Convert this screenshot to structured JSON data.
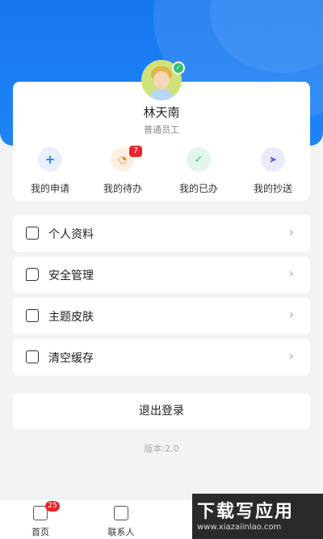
{
  "user": {
    "name": "林天南",
    "role": "普通员工"
  },
  "quick_actions": [
    {
      "label": "我的申请",
      "icon": "plus-icon",
      "color": "#2a7cf0",
      "bg": "#e6f0ff"
    },
    {
      "label": "我的待办",
      "icon": "clock-icon",
      "color": "#f08a24",
      "bg": "#fff0e2",
      "badge": "7"
    },
    {
      "label": "我的已办",
      "icon": "check-icon",
      "color": "#2fbf71",
      "bg": "#e3f6ec"
    },
    {
      "label": "我的抄送",
      "icon": "send-icon",
      "color": "#5b5fe0",
      "bg": "#ebeafc"
    }
  ],
  "menu": [
    {
      "label": "个人资料",
      "icon": "profile-card-icon"
    },
    {
      "label": "安全管理",
      "icon": "security-chat-icon"
    },
    {
      "label": "主题皮肤",
      "icon": "theme-icon"
    },
    {
      "label": "清空缓存",
      "icon": "clear-cache-icon"
    }
  ],
  "logout_label": "退出登录",
  "version": "版本:2.0",
  "tabbar": [
    {
      "label": "首页",
      "icon": "home-icon",
      "badge": "25"
    },
    {
      "label": "联系人",
      "icon": "contacts-icon"
    }
  ],
  "watermark": {
    "title": "下载写应用",
    "url": "www.xiazaiinlao.com"
  },
  "colors": {
    "primary": "#1677f0",
    "badge": "#e8262b",
    "background": "#f2f3f5"
  }
}
